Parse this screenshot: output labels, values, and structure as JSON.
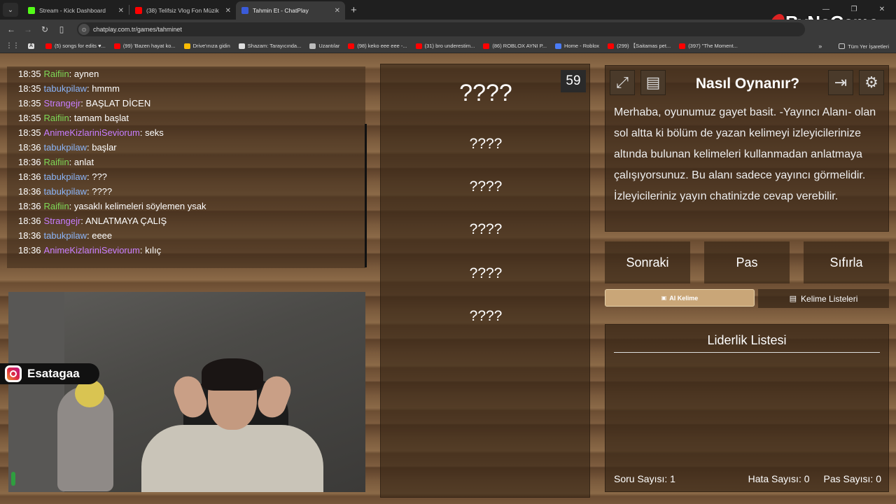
{
  "browser": {
    "tabs": [
      {
        "label": "Stream - Kick Dashboard",
        "active": false
      },
      {
        "label": "(38) Telifsiz Vlog Fon Müzik",
        "active": false
      },
      {
        "label": "Tahmin Et - ChatPlay",
        "active": true
      }
    ],
    "url": "chatplay.com.tr/games/tahminet",
    "bookmarks": [
      "(5) songs for edits ♥...",
      "(99) 'Bazen hayat ko...",
      "Drive'ınıza gidin",
      "Shazam: Tarayıcında...",
      "Uzantılar",
      "(98) keko eee eee -...",
      "(31) bro underestim...",
      "(86) ROBLOX AYNI P...",
      "Home - Roblox",
      "(299) 【Saitamas pet...",
      "(397) \"The Moment..."
    ],
    "all_bookmarks": "Tüm Yer İşaretleri"
  },
  "watermark": "ByNoGame",
  "chat": {
    "messages": [
      {
        "time": "18:35",
        "user": "Raifiin",
        "color": "#7ed957",
        "text": "aynen"
      },
      {
        "time": "18:35",
        "user": "tabukpilaw",
        "color": "#8ab4f8",
        "text": "hmmm"
      },
      {
        "time": "18:35",
        "user": "Strangejr",
        "color": "#c77dff",
        "text": "BAŞLAT DİCEN"
      },
      {
        "time": "18:35",
        "user": "Raifiin",
        "color": "#7ed957",
        "text": "tamam başlat"
      },
      {
        "time": "18:35",
        "user": "AnimeKizlariniSeviorum",
        "color": "#c77dff",
        "text": "seks"
      },
      {
        "time": "18:36",
        "user": "tabukpilaw",
        "color": "#8ab4f8",
        "text": "başlar"
      },
      {
        "time": "18:36",
        "user": "Raifiin",
        "color": "#7ed957",
        "text": "anlat"
      },
      {
        "time": "18:36",
        "user": "tabukpilaw",
        "color": "#8ab4f8",
        "text": "???"
      },
      {
        "time": "18:36",
        "user": "tabukpilaw",
        "color": "#8ab4f8",
        "text": "????"
      },
      {
        "time": "18:36",
        "user": "Raifiin",
        "color": "#7ed957",
        "text": "yasaklı kelimeleri söylemen ysak"
      },
      {
        "time": "18:36",
        "user": "Strangejr",
        "color": "#c77dff",
        "text": "ANLATMAYA ÇALIŞ"
      },
      {
        "time": "18:36",
        "user": "tabukpilaw",
        "color": "#8ab4f8",
        "text": "eeee"
      },
      {
        "time": "18:36",
        "user": "AnimeKizlariniSeviorum",
        "color": "#c77dff",
        "text": "kılıç"
      }
    ]
  },
  "instagram_handle": "Esatagaa",
  "game": {
    "timer": "59",
    "main_word": "????",
    "forbidden_words": [
      "????",
      "????",
      "????",
      "????",
      "????"
    ]
  },
  "howto": {
    "title": "Nasıl Oynanır?",
    "body": "Merhaba, oyunumuz gayet basit. -Yayıncı Alanı- olan sol altta ki bölüm de yazan kelimeyi izleyicilerinize altında bulunan kelimeleri kullanmadan anlatmaya çalışıyorsunuz. Bu alanı sadece yayıncı görmelidir. İzleyicileriniz yayın chatinizde cevap verebilir."
  },
  "buttons": {
    "next": "Sonraki",
    "pass": "Pas",
    "reset": "Sıfırla",
    "ai_word": "AI Kelime",
    "word_lists": "Kelime Listeleri"
  },
  "leaderboard": {
    "title": "Liderlik Listesi",
    "question_count": "Soru Sayısı: 1",
    "error_count": "Hata Sayısı: 0",
    "pass_count": "Pas Sayısı: 0"
  }
}
